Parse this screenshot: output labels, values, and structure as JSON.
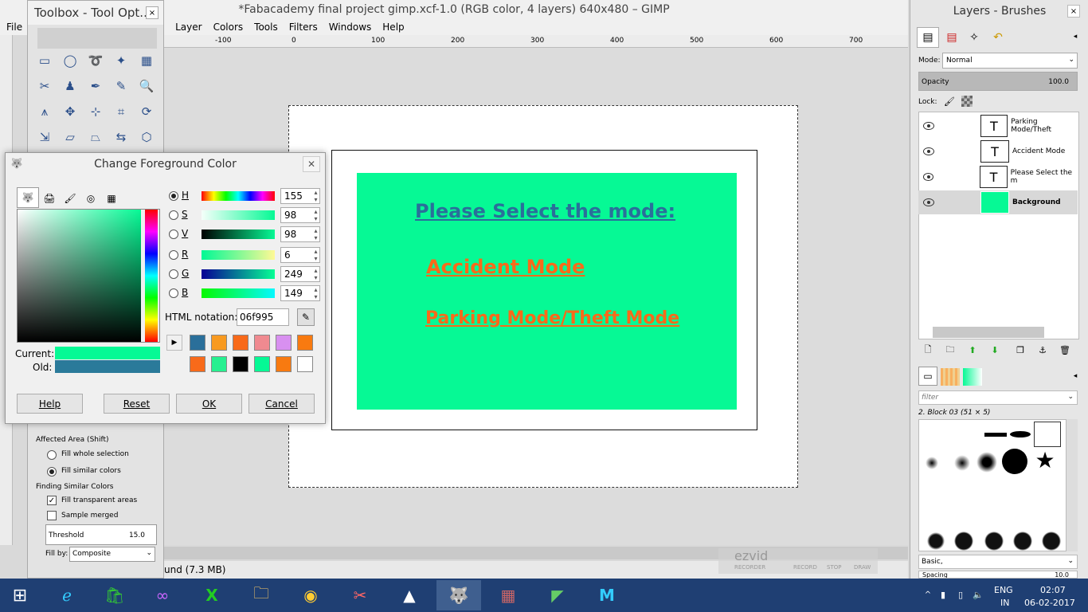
{
  "window_title": "*Fabacademy final project gimp.xcf-1.0 (RGB color, 4 layers) 640x480 – GIMP",
  "menu": [
    "File",
    "Layer",
    "Colors",
    "Tools",
    "Filters",
    "Windows",
    "Help"
  ],
  "ruler_ticks": [
    "-100",
    "0",
    "100",
    "200",
    "300",
    "400",
    "500",
    "600",
    "700"
  ],
  "status_text": "und (7.3 MB)",
  "toolbox": {
    "title": "Toolbox - Tool Opt...",
    "affected_area": "Affected Area  (Shift)",
    "fill_whole": "Fill whole selection",
    "fill_similar": "Fill similar colors",
    "finding_similar": "Finding Similar Colors",
    "fill_transparent": "Fill transparent areas",
    "sample_merged": "Sample merged",
    "threshold_label": "Threshold",
    "threshold_value": "15.0",
    "fill_by_label": "Fill by:",
    "fill_by_value": "Composite"
  },
  "dialog": {
    "title": "Change Foreground Color",
    "channels": [
      {
        "label": "H",
        "value": "155",
        "selected": true
      },
      {
        "label": "S",
        "value": "98",
        "selected": false
      },
      {
        "label": "V",
        "value": "98",
        "selected": false
      },
      {
        "label": "R",
        "value": "6",
        "selected": false
      },
      {
        "label": "G",
        "value": "249",
        "selected": false
      },
      {
        "label": "B",
        "value": "149",
        "selected": false
      }
    ],
    "html_label": "HTML notation:",
    "html_value": "06f995",
    "current_label": "Current:",
    "old_label": "Old:",
    "current_color": "#06f995",
    "old_color": "#2a7a9a",
    "history": [
      "#2a6f9a",
      "#f89a20",
      "#f86a1a",
      "#f08a90",
      "#d890f0",
      "#f87a10",
      "#f86a1a",
      "#26f090",
      "#000000",
      "#06f995",
      "#f87a10",
      "#ffffff"
    ],
    "buttons": {
      "help": "Help",
      "reset": "Reset",
      "ok": "OK",
      "cancel": "Cancel"
    }
  },
  "canvas": {
    "bg_color": "#06f995",
    "heading": "Please Select the mode:",
    "option1": "Accident Mode",
    "option2": "Parking Mode/Theft Mode"
  },
  "layers": {
    "title": "Layers - Brushes",
    "mode_label": "Mode:",
    "mode_value": "Normal",
    "opacity_label": "Opacity",
    "opacity_value": "100.0",
    "lock_label": "Lock:",
    "items": [
      "Parking Mode/Theft",
      "Accident Mode",
      "Please Select the m",
      "Background"
    ]
  },
  "brushes": {
    "filter_placeholder": "filter",
    "brush_name": "2. Block 03 (51 × 5)",
    "preset": "Basic,",
    "spacing_label": "Spacing",
    "spacing_value": "10.0"
  },
  "taskbar": {
    "lang1": "ENG",
    "lang2": "IN",
    "time": "02:07",
    "date": "06-02-2017"
  },
  "watermark": {
    "brand": "ezvid",
    "sub": "RECORDER",
    "rec": "RECORD",
    "stop": "STOP",
    "draw": "DRAW"
  }
}
